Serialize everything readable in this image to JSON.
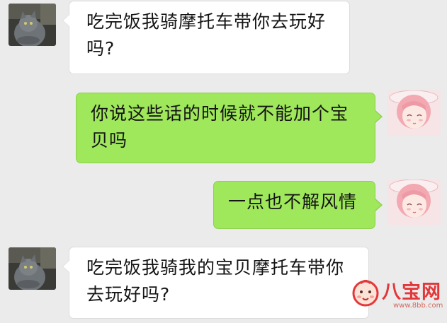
{
  "messages": [
    {
      "id": "msg-1",
      "sender": "other",
      "avatar": "cat-photo",
      "lines": [
        "吃完饭我骑摩托车带你去玩好",
        "吗?"
      ]
    },
    {
      "id": "msg-2",
      "sender": "self",
      "avatar": "anime-girl",
      "lines": [
        "你说这些话的时候就不能加个宝",
        "贝吗"
      ]
    },
    {
      "id": "msg-3",
      "sender": "self",
      "avatar": "anime-girl",
      "lines": [
        "一点也不解风情"
      ]
    },
    {
      "id": "msg-4",
      "sender": "other",
      "avatar": "cat-photo",
      "lines": [
        "吃完饭我骑我的宝贝摩托车带你",
        "去玩好吗?"
      ]
    }
  ],
  "watermark": {
    "brand": "八宝网",
    "url": "www.8bb.com",
    "color": "#e3383a"
  },
  "colors": {
    "background": "#ebebeb",
    "incoming_bubble": "#ffffff",
    "outgoing_bubble": "#9fe75b"
  }
}
